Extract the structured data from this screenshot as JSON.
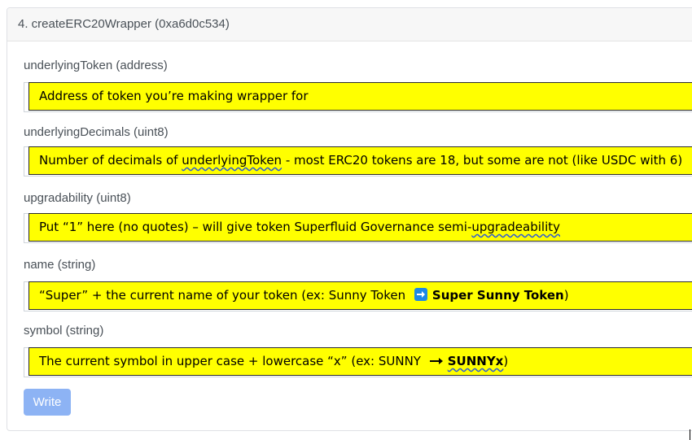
{
  "function_header": "4. createERC20Wrapper (0xa6d0c534)",
  "fields": [
    {
      "label": "underlyingToken (address)",
      "note": "Address of token you’re making wrapper for"
    },
    {
      "label": "underlyingDecimals (uint8)",
      "note_parts": [
        "Number of decimals of ",
        "underlyingToken",
        " - most ERC20 tokens are 18, but some are not (like USDC with 6)"
      ]
    },
    {
      "label": "upgradability (uint8)",
      "note_parts": [
        "Put “1” here (no quotes) – will give token Superfluid Governance semi-",
        "upgradeability"
      ]
    },
    {
      "label": "name (string)",
      "note_parts": [
        "“Super” + the current name of your token (ex: Sunny Token ",
        "Super Sunny Token",
        ")"
      ],
      "icon": "right-arrow-icon"
    },
    {
      "label": "symbol (string)",
      "note_parts": [
        "The current symbol in upper case + lowercase “x” (ex: SUNNY ",
        "SUNNYx",
        ")"
      ],
      "icon": "long-right-arrow-icon"
    }
  ],
  "write_button": "Write",
  "colors": {
    "note_highlight": "#ffff00",
    "button_bg": "#8db3f4",
    "icon_blue": "#1e88e5"
  }
}
